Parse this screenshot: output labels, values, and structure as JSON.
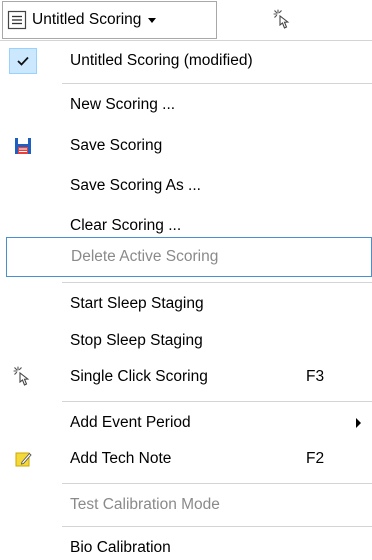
{
  "toolbar": {
    "scoring_dropdown": {
      "icon": "list-icon",
      "label": "Untitled Scoring"
    },
    "single_click_icon": "hand-pointer-click-icon"
  },
  "menu": {
    "current": {
      "label": "Untitled Scoring (modified)",
      "checked": true,
      "icon": "checkmark-icon"
    },
    "new": {
      "label": "New Scoring ..."
    },
    "save": {
      "label": "Save Scoring",
      "icon": "floppy-disk-icon"
    },
    "save_as": {
      "label": "Save Scoring As ..."
    },
    "clear": {
      "label": "Clear Scoring ..."
    },
    "delete": {
      "label": "Delete Active Scoring",
      "disabled": true
    },
    "start_staging": {
      "label": "Start Sleep Staging"
    },
    "stop_staging": {
      "label": "Stop Sleep Staging"
    },
    "single_click": {
      "label": "Single Click Scoring",
      "shortcut": "F3",
      "icon": "hand-pointer-click-icon"
    },
    "add_event": {
      "label": "Add Event Period",
      "has_submenu": true
    },
    "tech_note": {
      "label": "Add Tech Note",
      "shortcut": "F2",
      "icon": "note-pencil-icon"
    },
    "test_calibration": {
      "label": "Test Calibration Mode",
      "disabled": true
    },
    "bio_calibration": {
      "label": "Bio Calibration"
    }
  },
  "colors": {
    "check_highlight": "#cce8ff",
    "focus_border": "#4a8fd0",
    "disabled_text": "#8a8a8a",
    "save_icon_blue": "#1f5fbf",
    "note_icon_yellow": "#f5d93b"
  }
}
